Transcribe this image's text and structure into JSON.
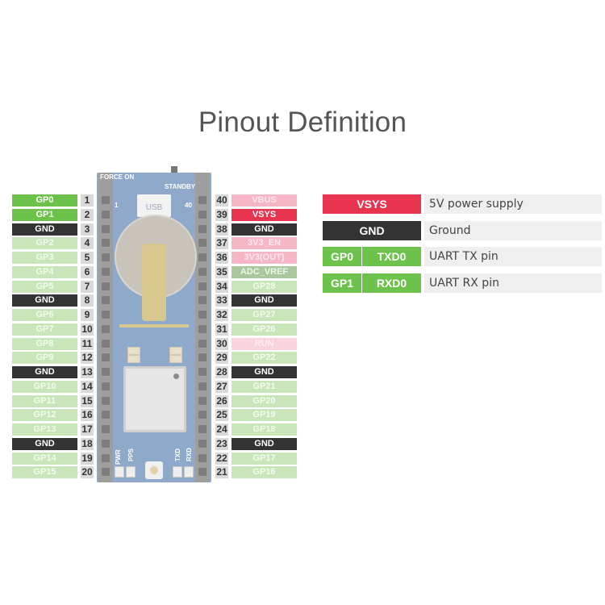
{
  "title": "Pinout Definition",
  "board": {
    "labels": {
      "force_on": "FORCE ON",
      "standby": "STANDBY",
      "usb": "USB",
      "pin1": "1",
      "pin40": "40",
      "pwr": "PWR",
      "pps": "PPS",
      "txd": "TXD",
      "rxd": "RXD"
    }
  },
  "colors": {
    "gpio": "#c8e6b9",
    "gpio_active": "#6cc24a",
    "gnd": "#333333",
    "power": "#e8344f",
    "power_light": "#f5b7c5",
    "adc": "#a9c89e",
    "run": "#f9d4dc"
  },
  "left_pins": [
    {
      "num": "1",
      "label": "GP0",
      "type": "gpio-active"
    },
    {
      "num": "2",
      "label": "GP1",
      "type": "gpio-active"
    },
    {
      "num": "3",
      "label": "GND",
      "type": "gnd"
    },
    {
      "num": "4",
      "label": "GP2",
      "type": "gpio"
    },
    {
      "num": "5",
      "label": "GP3",
      "type": "gpio"
    },
    {
      "num": "6",
      "label": "GP4",
      "type": "gpio"
    },
    {
      "num": "7",
      "label": "GP5",
      "type": "gpio"
    },
    {
      "num": "8",
      "label": "GND",
      "type": "gnd"
    },
    {
      "num": "9",
      "label": "GP6",
      "type": "gpio"
    },
    {
      "num": "10",
      "label": "GP7",
      "type": "gpio"
    },
    {
      "num": "11",
      "label": "GP8",
      "type": "gpio"
    },
    {
      "num": "12",
      "label": "GP9",
      "type": "gpio"
    },
    {
      "num": "13",
      "label": "GND",
      "type": "gnd"
    },
    {
      "num": "14",
      "label": "GP10",
      "type": "gpio"
    },
    {
      "num": "15",
      "label": "GP11",
      "type": "gpio"
    },
    {
      "num": "16",
      "label": "GP12",
      "type": "gpio"
    },
    {
      "num": "17",
      "label": "GP13",
      "type": "gpio"
    },
    {
      "num": "18",
      "label": "GND",
      "type": "gnd"
    },
    {
      "num": "19",
      "label": "GP14",
      "type": "gpio"
    },
    {
      "num": "20",
      "label": "GP15",
      "type": "gpio"
    }
  ],
  "right_pins": [
    {
      "num": "40",
      "label": "VBUS",
      "type": "power-light"
    },
    {
      "num": "39",
      "label": "VSYS",
      "type": "power"
    },
    {
      "num": "38",
      "label": "GND",
      "type": "gnd"
    },
    {
      "num": "37",
      "label": "3V3_EN",
      "type": "power-light"
    },
    {
      "num": "36",
      "label": "3V3(OUT)",
      "type": "power-light"
    },
    {
      "num": "35",
      "label": "ADC_VREF",
      "type": "adc"
    },
    {
      "num": "34",
      "label": "GP28",
      "type": "gpio"
    },
    {
      "num": "33",
      "label": "GND",
      "type": "gnd"
    },
    {
      "num": "32",
      "label": "GP27",
      "type": "gpio"
    },
    {
      "num": "31",
      "label": "GP26",
      "type": "gpio"
    },
    {
      "num": "30",
      "label": "RUN",
      "type": "run"
    },
    {
      "num": "29",
      "label": "GP22",
      "type": "gpio"
    },
    {
      "num": "28",
      "label": "GND",
      "type": "gnd"
    },
    {
      "num": "27",
      "label": "GP21",
      "type": "gpio"
    },
    {
      "num": "26",
      "label": "GP20",
      "type": "gpio"
    },
    {
      "num": "25",
      "label": "GP19",
      "type": "gpio"
    },
    {
      "num": "24",
      "label": "GP18",
      "type": "gpio"
    },
    {
      "num": "23",
      "label": "GND",
      "type": "gnd"
    },
    {
      "num": "22",
      "label": "GP17",
      "type": "gpio"
    },
    {
      "num": "21",
      "label": "GP16",
      "type": "gpio"
    }
  ],
  "legend": [
    {
      "cells": [
        {
          "text": "VSYS",
          "type": "power"
        }
      ],
      "description": "5V power supply"
    },
    {
      "cells": [
        {
          "text": "GND",
          "type": "gnd"
        }
      ],
      "description": "Ground"
    },
    {
      "cells": [
        {
          "text": "GP0",
          "type": "gpio-active"
        },
        {
          "text": "TXD0",
          "type": "gpio-active"
        }
      ],
      "description": "UART TX pin"
    },
    {
      "cells": [
        {
          "text": "GP1",
          "type": "gpio-active"
        },
        {
          "text": "RXD0",
          "type": "gpio-active"
        }
      ],
      "description": "UART RX pin"
    }
  ]
}
